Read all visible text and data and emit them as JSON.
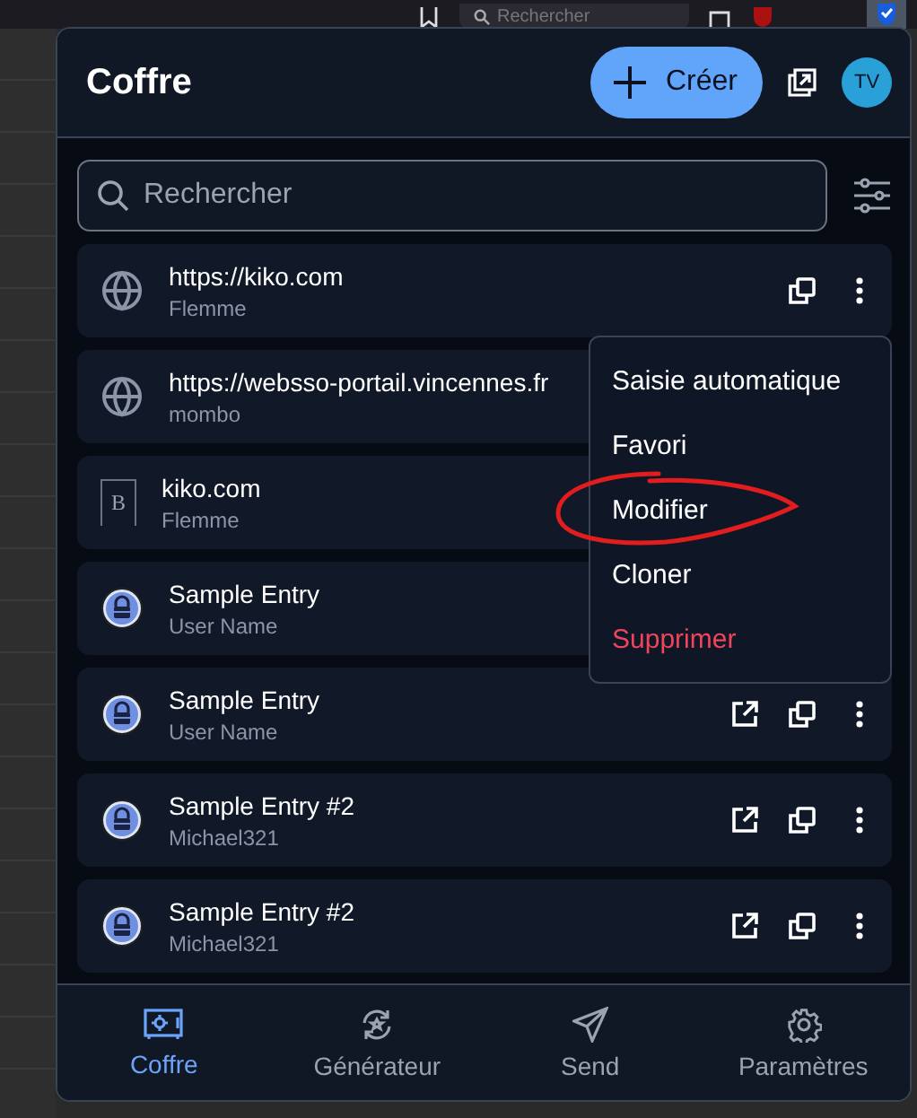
{
  "browser": {
    "search_placeholder": "Rechercher"
  },
  "header": {
    "title": "Coffre",
    "create_label": "Créer",
    "avatar": "TV"
  },
  "search": {
    "placeholder": "Rechercher"
  },
  "items": [
    {
      "title": "https://kiko.com",
      "subtitle": "Flemme",
      "kind": "globe",
      "actions": [
        {
          "kind": "copy"
        },
        {
          "kind": "more"
        }
      ]
    },
    {
      "title": "https://websso-portail.vincennes.fr",
      "subtitle": "mombo",
      "kind": "globe"
    },
    {
      "title": "kiko.com",
      "subtitle": "Flemme",
      "kind": "brand",
      "brand_letter": "B"
    },
    {
      "title": "Sample Entry",
      "subtitle": "User Name",
      "kind": "lock"
    },
    {
      "title": "Sample Entry",
      "subtitle": "User Name",
      "kind": "lock",
      "actions": [
        {
          "kind": "launch"
        },
        {
          "kind": "copy"
        },
        {
          "kind": "more"
        }
      ]
    },
    {
      "title": "Sample Entry #2",
      "subtitle": "Michael321",
      "kind": "lock",
      "actions": [
        {
          "kind": "launch"
        },
        {
          "kind": "copy"
        },
        {
          "kind": "more"
        }
      ]
    },
    {
      "title": "Sample Entry #2",
      "subtitle": "Michael321",
      "kind": "lock",
      "actions": [
        {
          "kind": "launch"
        },
        {
          "kind": "copy"
        },
        {
          "kind": "more"
        }
      ]
    }
  ],
  "menu": {
    "items": [
      {
        "label": "Saisie automatique",
        "danger": false,
        "circled": false
      },
      {
        "label": "Favori",
        "danger": false,
        "circled": false
      },
      {
        "label": "Modifier",
        "danger": false,
        "circled": true
      },
      {
        "label": "Cloner",
        "danger": false,
        "circled": false
      },
      {
        "label": "Supprimer",
        "danger": true,
        "circled": false
      }
    ]
  },
  "nav": [
    {
      "label": "Coffre",
      "kind": "vault",
      "selected": true
    },
    {
      "label": "Générateur",
      "kind": "generator",
      "selected": false
    },
    {
      "label": "Send",
      "kind": "send",
      "selected": false
    },
    {
      "label": "Paramètres",
      "kind": "gear",
      "selected": false
    }
  ]
}
